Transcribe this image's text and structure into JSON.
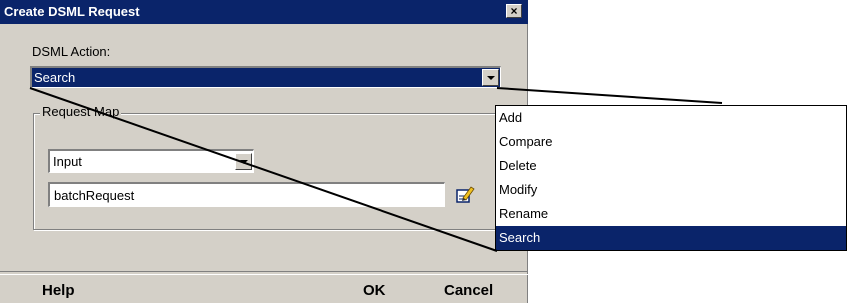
{
  "dialog": {
    "title": "Create DSML Request",
    "close_label": "×",
    "action_label": "DSML Action:",
    "action_value": "Search",
    "group_label": "Request Map",
    "input_combo_value": "Input",
    "text_field_value": "batchRequest",
    "buttons": {
      "help": "Help",
      "ok": "OK",
      "cancel": "Cancel"
    }
  },
  "dropdown": {
    "items": [
      "Add",
      "Compare",
      "Delete",
      "Modify",
      "Rename",
      "Search"
    ],
    "selected": "Search"
  },
  "colors": {
    "titlebar": "#0a246a",
    "dialog_bg": "#d4d0c8",
    "selection": "#0a246a"
  }
}
